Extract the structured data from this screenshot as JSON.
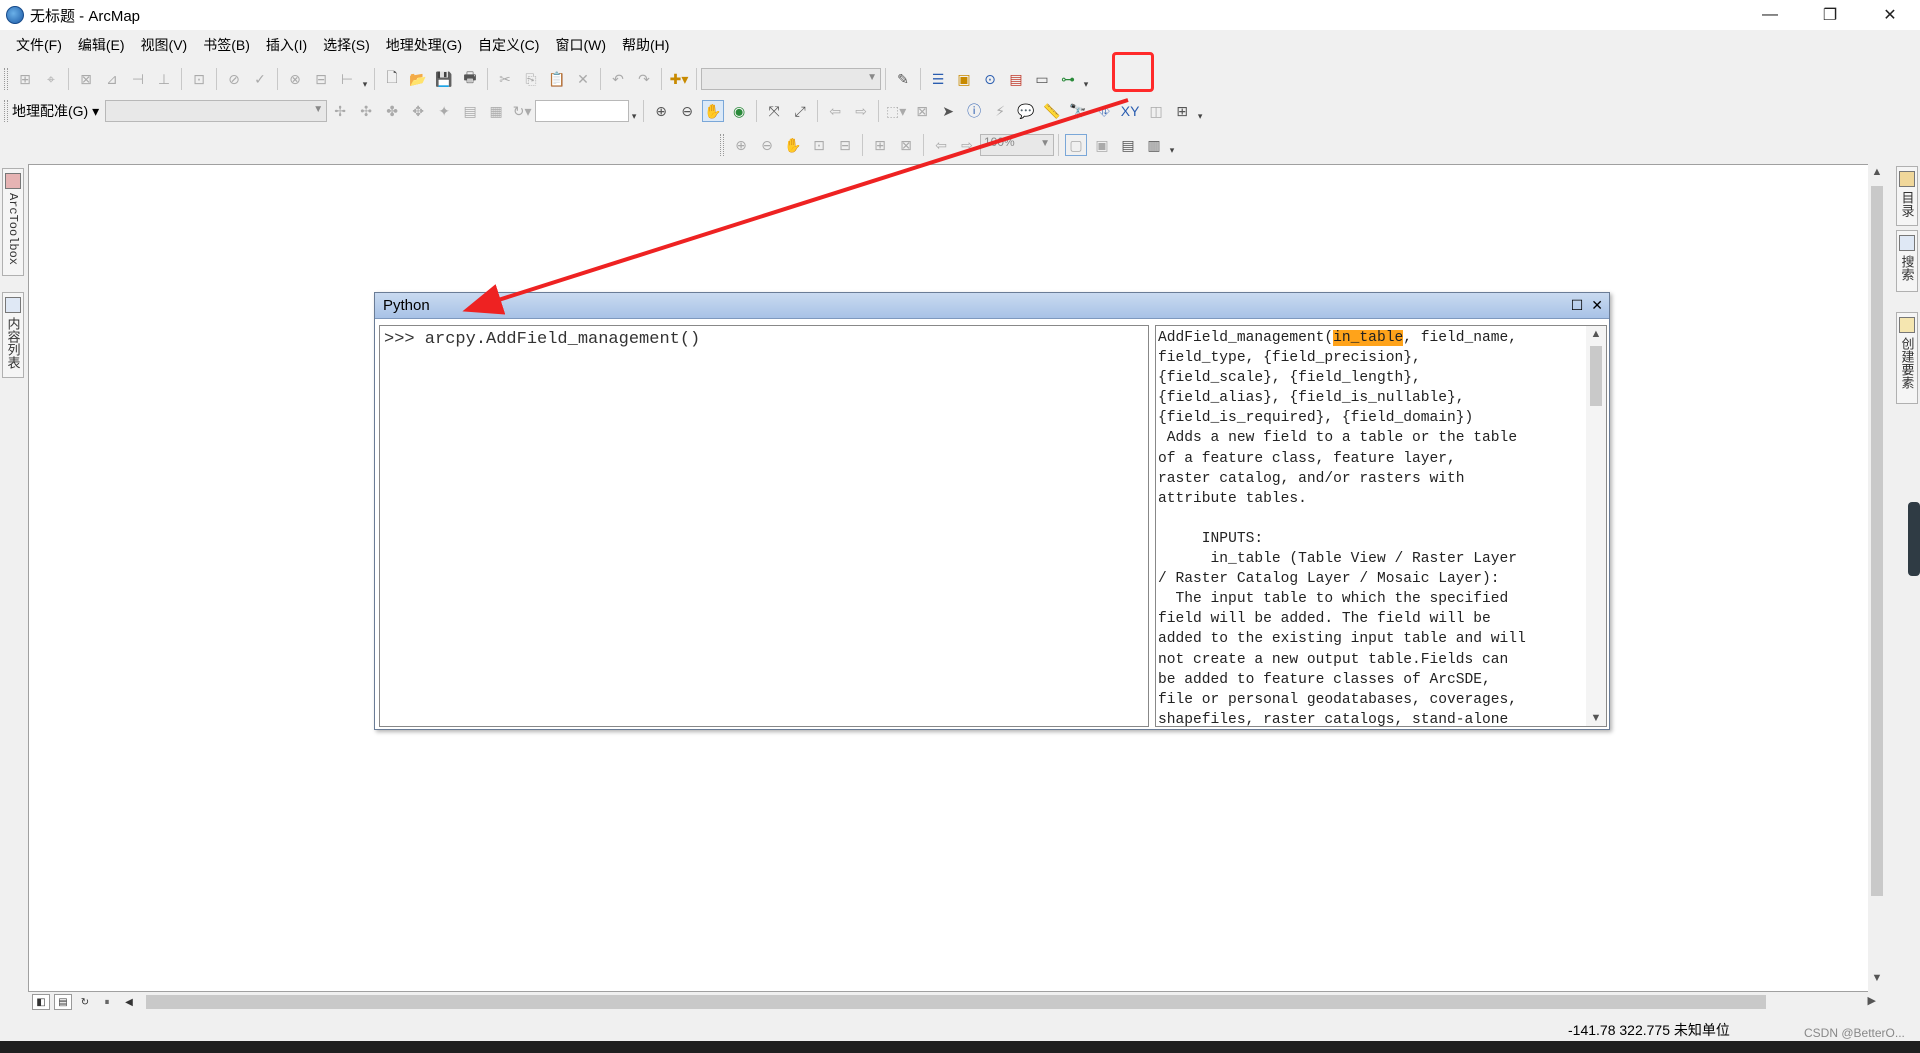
{
  "window": {
    "title": "无标题 - ArcMap",
    "minimize": "—",
    "maximize": "❐",
    "close": "✕"
  },
  "menu": [
    "文件(F)",
    "编辑(E)",
    "视图(V)",
    "书签(B)",
    "插入(I)",
    "选择(S)",
    "地理处理(G)",
    "自定义(C)",
    "窗口(W)",
    "帮助(H)"
  ],
  "toolbar": {
    "georef_label": "地理配准(G) ▾",
    "zoom_value": "100%"
  },
  "left_dock": {
    "arctoolbox": "ArcToolbox",
    "toc": "内容列表"
  },
  "right_dock": {
    "catalog": "目录",
    "search": "搜索",
    "create_features": "创建要素"
  },
  "python_window": {
    "title": "Python",
    "maximize": "☐",
    "close": "✕",
    "console_line": ">>> arcpy.AddField_management()",
    "help_prefix": "AddField_management(",
    "help_highlight": "in_table",
    "help_rest": ", field_name,\nfield_type, {field_precision},\n{field_scale}, {field_length},\n{field_alias}, {field_is_nullable},\n{field_is_required}, {field_domain})\n Adds a new field to a table or the table\nof a feature class, feature layer,\nraster catalog, and/or rasters with\nattribute tables.\n\n     INPUTS:\n      in_table (Table View / Raster Layer\n/ Raster Catalog Layer / Mosaic Layer):\n  The input table to which the specified\nfield will be added. The field will be\nadded to the existing input table and will\nnot create a new output table.Fields can\nbe added to feature classes of ArcSDE,\nfile or personal geodatabases, coverages,\nshapefiles, raster catalogs, stand-alone"
  },
  "status": {
    "coords": "-141.78  322.775 未知单位",
    "watermark": "CSDN @BetterO..."
  },
  "colors": {
    "highlight_box": "#ff2a2a",
    "arrow": "#ee2222",
    "param_highlight": "#ffa31a"
  }
}
